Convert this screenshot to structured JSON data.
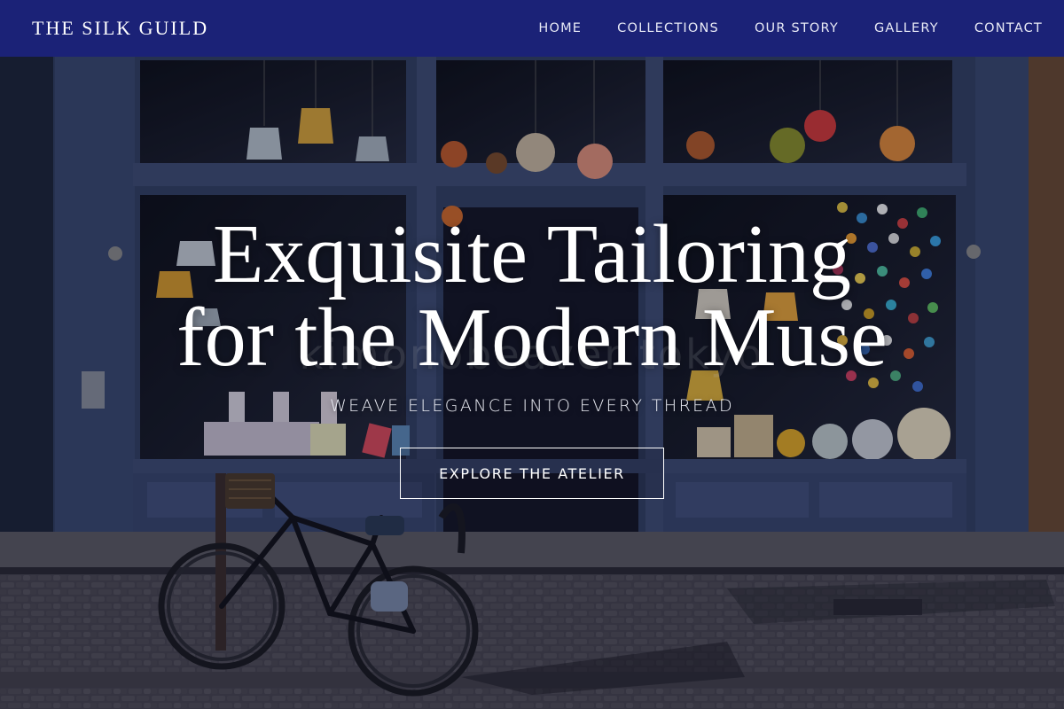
{
  "brand": {
    "name": "THE SILK GUILD"
  },
  "nav": {
    "items": [
      {
        "label": "HOME"
      },
      {
        "label": "COLLECTIONS"
      },
      {
        "label": "OUR STORY"
      },
      {
        "label": "GALLERY"
      },
      {
        "label": "CONTACT"
      }
    ]
  },
  "hero": {
    "title_line1": "Exquisite Tailoring",
    "title_line2": "for the Modern Muse",
    "subtitle": "WEAVE ELEGANCE INTO EVERY THREAD",
    "cta_label": "EXPLORE THE ATELIER"
  },
  "colors": {
    "header_bg": "#1b2277",
    "text": "#ffffff",
    "storefront": "#3d4a6c"
  }
}
